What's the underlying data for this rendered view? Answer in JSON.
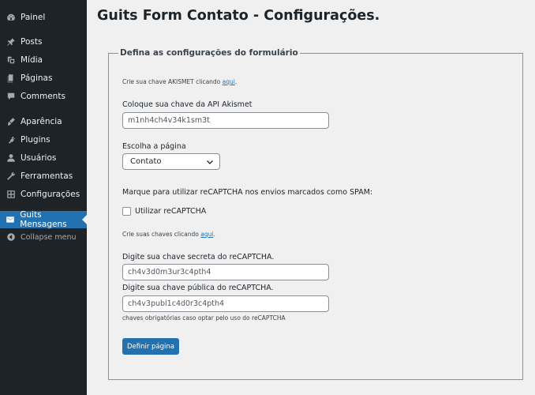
{
  "sidebar": {
    "items": [
      {
        "label": "Painel",
        "icon": "dashboard-icon"
      },
      {
        "label": "Posts",
        "icon": "pin-icon"
      },
      {
        "label": "Mídia",
        "icon": "media-icon"
      },
      {
        "label": "Páginas",
        "icon": "pages-icon"
      },
      {
        "label": "Comments",
        "icon": "comments-icon"
      },
      {
        "label": "Aparência",
        "icon": "appearance-icon"
      },
      {
        "label": "Plugins",
        "icon": "plugins-icon"
      },
      {
        "label": "Usuários",
        "icon": "users-icon"
      },
      {
        "label": "Ferramentas",
        "icon": "tools-icon"
      },
      {
        "label": "Configurações",
        "icon": "settings-icon"
      },
      {
        "label": "Guits Mensagens",
        "icon": "mail-icon",
        "current": true
      },
      {
        "label": "Collapse menu",
        "icon": "collapse-icon"
      }
    ],
    "colors": {
      "background": "#1d2327",
      "current": "#2271b1"
    }
  },
  "page": {
    "title": "Guits Form Contato - Configurações."
  },
  "form": {
    "legend": "Defina as configurações do formulário",
    "akismet_hint_text": "Crie sua chave AKISMET clicando",
    "akismet_hint_link": "aqui",
    "akismet_label": "Coloque sua chave da API Akismet",
    "akismet_value": "m1nh4ch4v34k1sm3t",
    "page_label": "Escolha a página",
    "page_selected": "Contato",
    "recaptcha_prompt": "Marque para utilizar reCAPTCHA nos envios marcados como SPAM:",
    "recaptcha_checkbox_label": "Utilizar reCAPTCHA",
    "recaptcha_checked": false,
    "keys_hint_text": "Crie suas chaves clicando",
    "keys_hint_link": "aqui",
    "secret_label": "Digite sua chave secreta do reCAPTCHA.",
    "secret_value": "ch4v3d0m3ur3c4pth4",
    "public_label": "Digite sua chave pública do reCAPTCHA.",
    "public_value": "ch4v3publ1c4d0r3c4pth4",
    "required_note": "chaves obrigatórias caso optar pelo uso do reCAPTCHA",
    "submit_label": "Definir página"
  }
}
